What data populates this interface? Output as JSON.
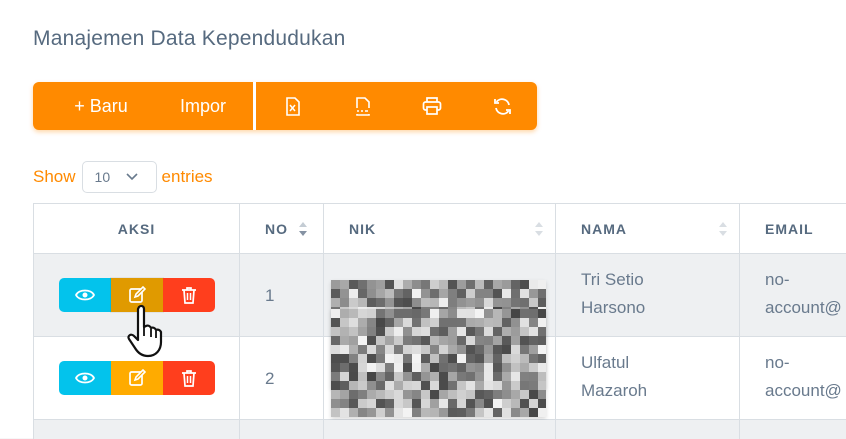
{
  "page": {
    "title": "Manajemen Data Kependudukan"
  },
  "toolbar": {
    "new_label": "+ Baru",
    "import_label": "Impor",
    "icons": [
      "excel-icon",
      "csv-icon",
      "print-icon",
      "refresh-icon"
    ],
    "color": "#ff8a00"
  },
  "length": {
    "show": "Show",
    "value": "10",
    "entries": "entries"
  },
  "table": {
    "headers": {
      "aksi": "AKSI",
      "no": "NO",
      "nik": "NIK",
      "nama": "NAMA",
      "email": "EMAIL"
    },
    "rows": [
      {
        "no": "1",
        "nama_line1": "Tri Setio",
        "nama_line2": "Harsono",
        "email_line1": "no-",
        "email_line2": "account@"
      },
      {
        "no": "2",
        "nama_line1": "Ulfatul",
        "nama_line2": "Mazaroh",
        "email_line1": "no-",
        "email_line2": "account@"
      }
    ]
  },
  "colors": {
    "view": "#03c3ec",
    "edit": "#ffab00",
    "delete": "#ff3e1d"
  }
}
